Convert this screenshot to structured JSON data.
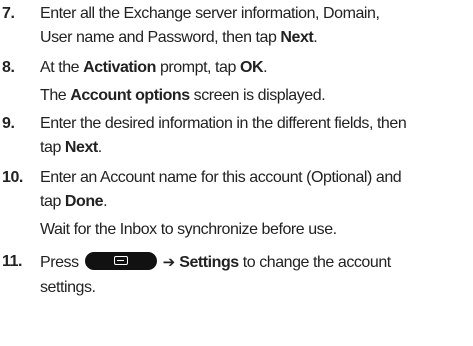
{
  "steps": [
    {
      "number": "7.",
      "line1_a": "Enter all the Exchange server information, Domain,",
      "line2_a": "User name and Password, then tap ",
      "line2_b": "Next",
      "line2_c": "."
    },
    {
      "number": "8.",
      "line1_a": "At the ",
      "line1_b": "Activation",
      "line1_c": " prompt, tap ",
      "line1_d": "OK",
      "line1_e": ".",
      "line2_a": "The ",
      "line2_b": "Account options",
      "line2_c": " screen is displayed."
    },
    {
      "number": "9.",
      "line1_a": "Enter the desired information in the different fields, then",
      "line2_a": "tap ",
      "line2_b": "Next",
      "line2_c": "."
    },
    {
      "number": "10.",
      "line1_a": "Enter an Account name for this account (Optional) and",
      "line2_a": "tap ",
      "line2_b": "Done",
      "line2_c": ".",
      "line3_a": "Wait for the Inbox to synchronize before use."
    },
    {
      "number": "11.",
      "line1_a": "Press ",
      "line1_arrow": "➔",
      "line1_b": "Settings",
      "line1_c": " to change the account",
      "line2_a": "settings.",
      "key_icon": "menu-key-icon"
    }
  ]
}
